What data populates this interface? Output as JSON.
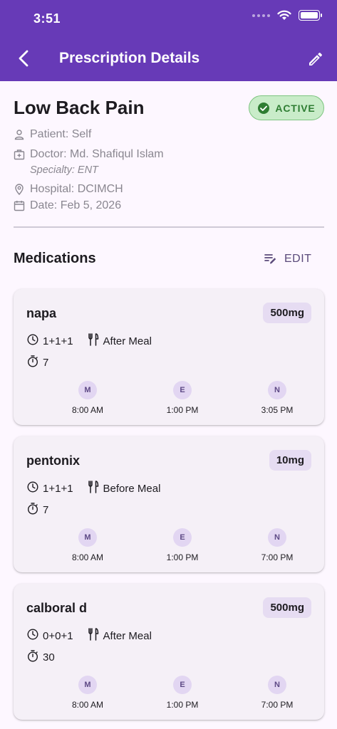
{
  "status_bar": {
    "time": "3:51"
  },
  "appbar": {
    "title": "Prescription Details"
  },
  "prescription": {
    "title": "Low Back Pain",
    "status": "ACTIVE",
    "patient": "Patient: Self",
    "doctor": "Doctor: Md. Shafiqul Islam",
    "specialty": "Specialty: ENT",
    "hospital": "Hospital: DCIMCH",
    "date": "Date: Feb 5, 2026"
  },
  "medications": {
    "section_title": "Medications",
    "edit_label": "EDIT",
    "items": [
      {
        "name": "napa",
        "dose": "500mg",
        "schedule": "1+1+1",
        "meal": "After Meal",
        "duration": "7",
        "slots": [
          {
            "letter": "M",
            "time": "8:00 AM"
          },
          {
            "letter": "E",
            "time": "1:00 PM"
          },
          {
            "letter": "N",
            "time": "3:05 PM"
          }
        ]
      },
      {
        "name": "pentonix",
        "dose": "10mg",
        "schedule": "1+1+1",
        "meal": "Before Meal",
        "duration": "7",
        "slots": [
          {
            "letter": "M",
            "time": "8:00 AM"
          },
          {
            "letter": "E",
            "time": "1:00 PM"
          },
          {
            "letter": "N",
            "time": "7:00 PM"
          }
        ]
      },
      {
        "name": "calboral d",
        "dose": "500mg",
        "schedule": "0+0+1",
        "meal": "After Meal",
        "duration": "30",
        "slots": [
          {
            "letter": "M",
            "time": "8:00 AM"
          },
          {
            "letter": "E",
            "time": "1:00 PM"
          },
          {
            "letter": "N",
            "time": "7:00 PM"
          }
        ]
      }
    ]
  },
  "colors": {
    "primary": "#673ab7",
    "active_green": "#2e7d32",
    "background": "#fdf7ff"
  },
  "icons": [
    "back-arrow-icon",
    "pencil-icon",
    "check-circle-icon",
    "person-icon",
    "medical-bag-icon",
    "location-pin-icon",
    "calendar-icon",
    "edit-note-icon",
    "clock-icon",
    "fork-knife-icon",
    "timer-icon"
  ]
}
